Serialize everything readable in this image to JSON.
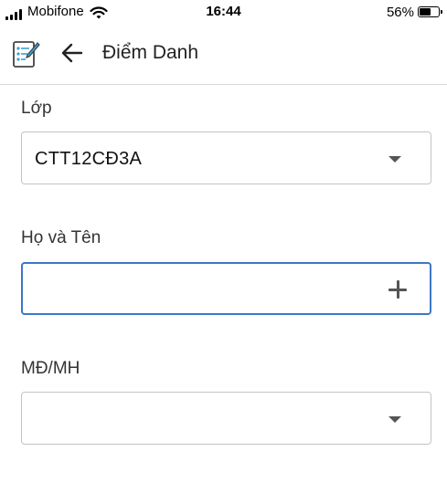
{
  "status_bar": {
    "carrier": "Mobifone",
    "time": "16:44",
    "battery_percent": "56%",
    "battery_level": 0.56,
    "icons": [
      "signal-icon",
      "wifi-icon",
      "battery-icon"
    ]
  },
  "header": {
    "title": "Điểm Danh",
    "icons": [
      "app-icon",
      "back-arrow-icon"
    ]
  },
  "form": {
    "lop": {
      "label": "Lớp",
      "value": "CTT12CĐ3A"
    },
    "ho_ten": {
      "label": "Họ và Tên",
      "value": ""
    },
    "md_mh": {
      "label": "MĐ/MH",
      "value": ""
    }
  },
  "colors": {
    "focus_border": "#3b78c4",
    "field_border": "#c4c4c4"
  }
}
